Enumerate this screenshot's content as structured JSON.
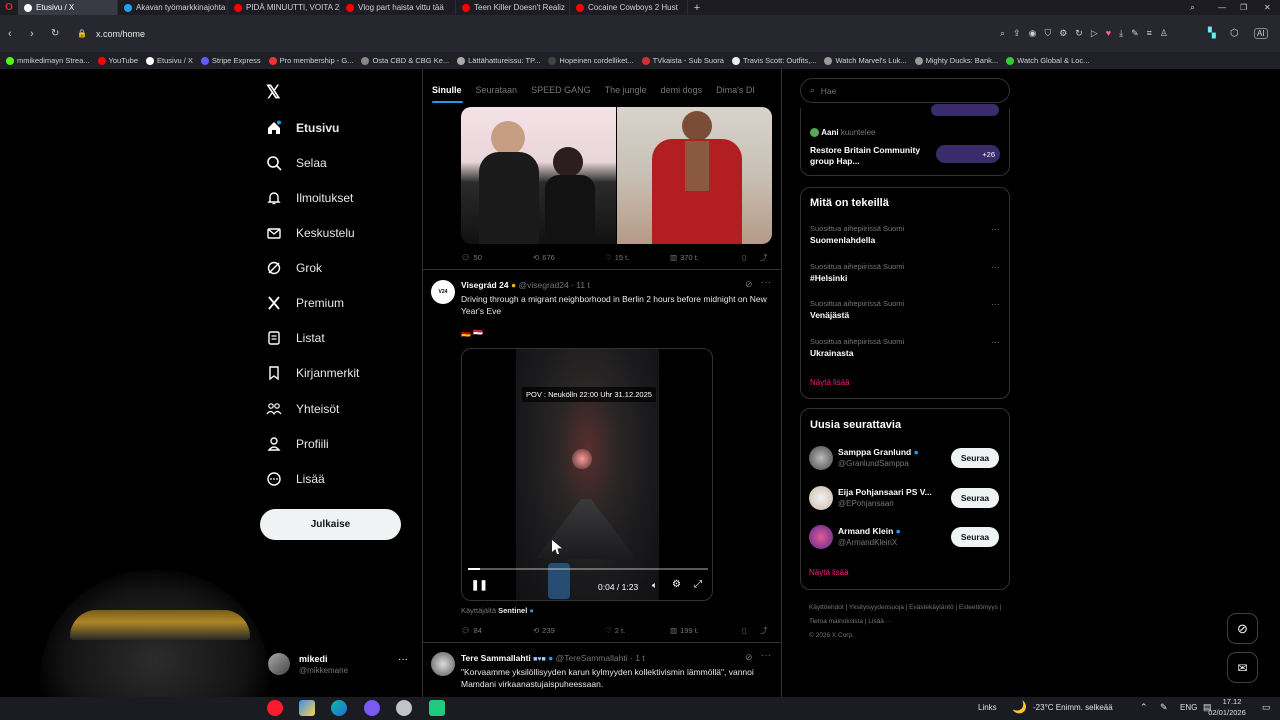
{
  "browser": {
    "tabs": [
      {
        "label": "Etusivu / X",
        "color": "#ffffff",
        "active": true
      },
      {
        "label": "Akavan työmarkkinajohta",
        "color": "#1da1f2"
      },
      {
        "label": "PIDÄ MINUUTTI, VOITA 20",
        "color": "#ff0000"
      },
      {
        "label": "Vlog part haista vittu tää",
        "color": "#ff0000"
      },
      {
        "label": "Teen Killer Doesn't Realiz",
        "color": "#ff0000"
      },
      {
        "label": "Cocaine Cowboys 2 Hust",
        "color": "#ff0000"
      }
    ],
    "url": "x.com/home",
    "bookmarks": [
      "mmikedimayn Strea...",
      "YouTube",
      "Etusivu / X",
      "Stripe Express",
      "Pro membership - G...",
      "Osta CBD & CBG Ke...",
      "Lättähattureissu: TP...",
      "Hopeinen cordelliket...",
      "TVkaista - Sub Suora",
      "Travis Scott: Outfits,...",
      "Watch Marvel's Luk...",
      "Mighty Ducks: Bank...",
      "Watch Global & Loc..."
    ]
  },
  "nav": {
    "items": [
      {
        "label": "Etusivu"
      },
      {
        "label": "Selaa"
      },
      {
        "label": "Ilmoitukset"
      },
      {
        "label": "Keskustelu"
      },
      {
        "label": "Grok"
      },
      {
        "label": "Premium"
      },
      {
        "label": "Listat"
      },
      {
        "label": "Kirjanmerkit"
      },
      {
        "label": "Yhteisöt"
      },
      {
        "label": "Profiili"
      },
      {
        "label": "Lisää"
      }
    ],
    "post_button": "Julkaise",
    "user": {
      "name": "mikedi",
      "handle": "@mikkemane"
    }
  },
  "feed": {
    "tabs": [
      "Sinulle",
      "Seurataan",
      "SPEED GANG",
      "The jungle",
      "demi dogs",
      "Dima's DI"
    ],
    "post1": {
      "replies": "50",
      "reposts": "676",
      "likes": "15 t.",
      "views": "370 t."
    },
    "post2": {
      "author": "Visegrád 24",
      "handle": "@visegrad24",
      "time": "11 t",
      "text": "Driving through a migrant neighborhood in Berlin 2 hours before midnight on New Year's Eve",
      "flags": "🇩🇪 🇪🇬",
      "video_caption": "POV : Neukölln 22:00 Uhr 31.12.2025",
      "video_time": "0:04 / 1:23",
      "video_progress": 0.05,
      "from_user_prefix": "Käyttäjältä",
      "from_user": "Sentinel",
      "replies": "84",
      "reposts": "239",
      "likes": "2 t.",
      "views": "199 t."
    },
    "post3": {
      "author": "Tere Sammallahti",
      "handle": "@TereSammallahti",
      "time": "1 t",
      "text": "\"Korvaamme yksilöllisyyden karun kylmyyden kollektivismin lämmöllä\", vannoi Mamdani virkaanastujaispuheessaan."
    }
  },
  "right": {
    "search_placeholder": "Hae",
    "space": {
      "name": "Aani",
      "status": "kuuntelee",
      "title": "Restore Britain Community group Hap...",
      "count": "+26"
    },
    "trending": {
      "title": "Mitä on tekeillä",
      "items": [
        {
          "context": "Suosittua aihepiirissä Suomi",
          "topic": "Suomenlahdella"
        },
        {
          "context": "Suosittua aihepiirissä Suomi",
          "topic": "#Helsinki"
        },
        {
          "context": "Suosittua aihepiirissä Suomi",
          "topic": "Venäjästä"
        },
        {
          "context": "Suosittua aihepiirissä Suomi",
          "topic": "Ukrainasta"
        }
      ],
      "show_more": "Näytä lisää"
    },
    "who_to_follow": {
      "title": "Uusia seurattavia",
      "users": [
        {
          "name": "Samppa Granlund",
          "handle": "@GranlundSamppa",
          "button": "Seuraa"
        },
        {
          "name": "Eija Pohjansaari PS V...",
          "handle": "@EPohjansaari",
          "button": "Seuraa"
        },
        {
          "name": "Armand Klein",
          "handle": "@ArmandKleinX",
          "button": "Seuraa"
        }
      ],
      "show_more": "Näytä lisää"
    },
    "footer": [
      "Käyttöehdot",
      "Yksityisyydensuoja",
      "Evästekäytäntö",
      "Esteettömyys",
      "Tietoa mainoksista",
      "Lisää ···",
      "© 2026 X Corp."
    ]
  },
  "taskbar": {
    "links": "Links",
    "weather": "-23°C  Enimm. selkeää",
    "lang": "ENG",
    "time": "17.12",
    "date": "02/01/2026"
  }
}
